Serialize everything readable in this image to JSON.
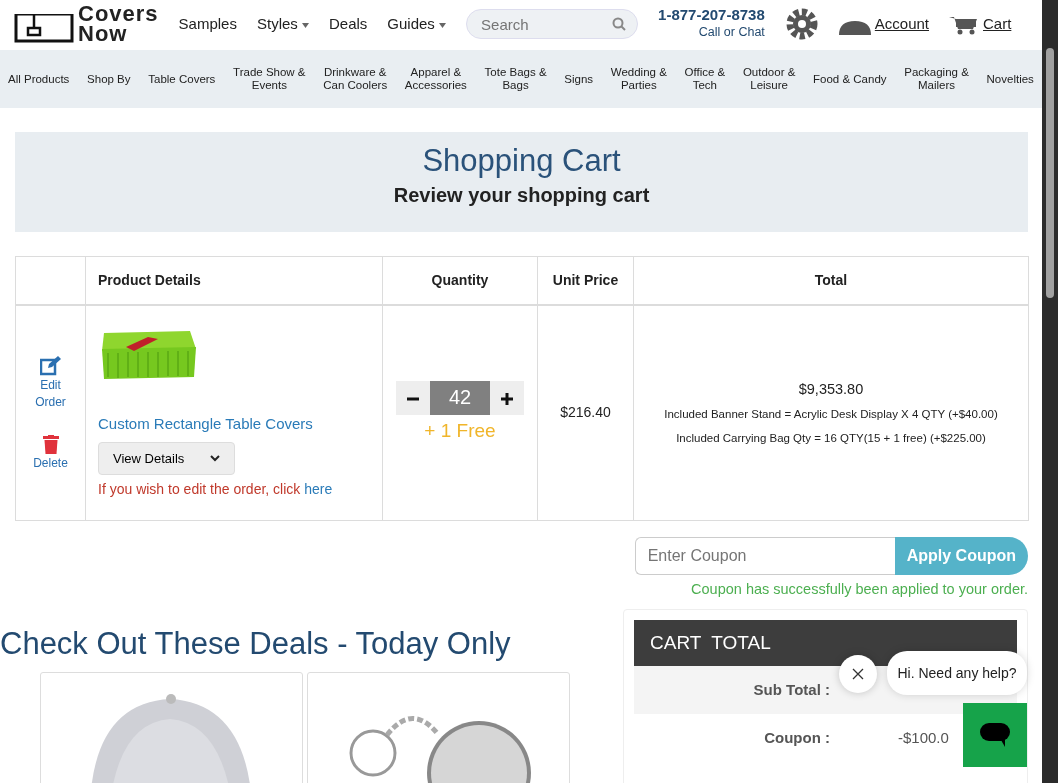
{
  "header": {
    "logo": [
      "Covers",
      "Now"
    ],
    "nav": [
      {
        "label": "Samples",
        "has_menu": false
      },
      {
        "label": "Styles",
        "has_menu": true
      },
      {
        "label": "Deals",
        "has_menu": false
      },
      {
        "label": "Guides",
        "has_menu": true
      }
    ],
    "search": {
      "placeholder": "Search"
    },
    "phone": "1-877-207-8738",
    "contact": {
      "text": "Call or",
      "link": "Chat"
    },
    "account": "Account",
    "cart": "Cart"
  },
  "categories": [
    "All Products",
    "Shop By",
    "Table Covers",
    "Trade Show & Events",
    "Drinkware & Can Coolers",
    "Apparel & Accessories",
    "Tote Bags & Bags",
    "Signs",
    "Wedding & Parties",
    "Office & Tech",
    "Outdoor & Leisure",
    "Food & Candy",
    "Packaging & Mailers",
    "Novelties"
  ],
  "banner": {
    "title": "Shopping Cart",
    "subtitle": "Review your shopping cart"
  },
  "cart_table": {
    "columns": [
      "Product Details",
      "Quantity",
      "Unit Price",
      "Total"
    ],
    "rows": [
      {
        "actions": [
          {
            "kind": "edit",
            "label": "Edit Order"
          },
          {
            "kind": "delete",
            "label": "Delete"
          }
        ],
        "product": "Custom Rectangle Table Covers",
        "details_button": "View Details",
        "edit_note": "If you wish to edit the order, click",
        "edit_link": "here",
        "quantity": "42",
        "free": "+ 1 Free",
        "unit_price": "$216.40",
        "total": "$9,353.80",
        "extras": [
          "Included Banner Stand = Acrylic Desk Display X 4 QTY (+$40.00)",
          "Included Carrying Bag Qty = 16 QTY(15 + 1 free) (+$225.00)"
        ]
      }
    ]
  },
  "coupon": {
    "placeholder": "Enter Coupon",
    "button": "Apply Coupon",
    "message": "Coupon has successfully been applied to your order."
  },
  "deals": {
    "title": "Check Out These Deals - Today Only"
  },
  "cart_total": {
    "title": "CART  TOTAL",
    "rows": [
      {
        "label": "Sub Total :"
      },
      {
        "label": "Coupon :",
        "value": "-$100.0"
      }
    ]
  },
  "chat": {
    "greeting": "Hi. Need any help?"
  }
}
